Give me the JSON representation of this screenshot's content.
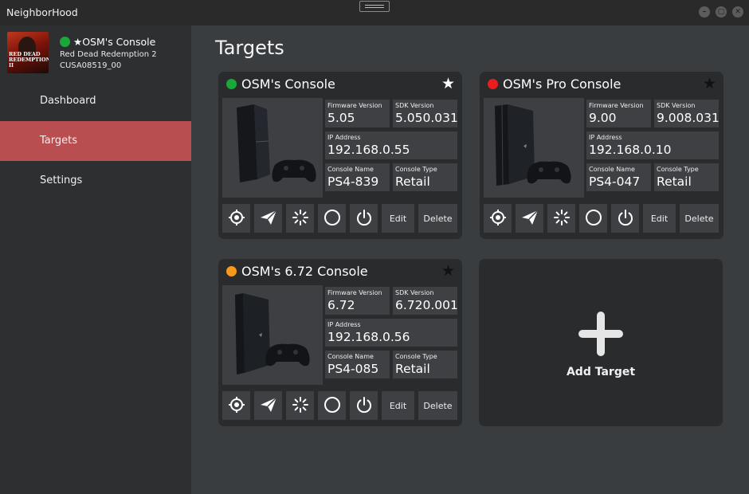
{
  "app": {
    "title": "NeighborHood"
  },
  "window": {
    "minimize_glyph": "–",
    "maximize_glyph": "▢",
    "close_glyph": "✕"
  },
  "sidebar": {
    "cover_text": "RED DEAD\nREDEMPTION II",
    "current_target": {
      "name": "★OSM's Console",
      "status_color": "#1aa83a"
    },
    "current_game": "Red Dead Redemption 2",
    "current_title_id": "CUSA08519_00",
    "nav": [
      {
        "label": "Dashboard",
        "active": false
      },
      {
        "label": "Targets",
        "active": true
      },
      {
        "label": "Settings",
        "active": false
      }
    ]
  },
  "page": {
    "title": "Targets"
  },
  "labels": {
    "firmware": "Firmware Version",
    "sdk": "SDK Version",
    "ip": "IP Address",
    "console_name": "Console Name",
    "console_type": "Console Type",
    "edit": "Edit",
    "delete": "Delete"
  },
  "targets": [
    {
      "name": "OSM's Console",
      "status_color": "#1aa83a",
      "default": true,
      "star_color": "#ffffff",
      "firmware": "5.05",
      "sdk": "5.050.031",
      "ip": "192.168.0.55",
      "console_name": "PS4-839",
      "console_type": "Retail",
      "model": "original"
    },
    {
      "name": "OSM's Pro Console",
      "status_color": "#e81d1d",
      "default": false,
      "star_color": "#111111",
      "firmware": "9.00",
      "sdk": "9.008.031",
      "ip": "192.168.0.10",
      "console_name": "PS4-047",
      "console_type": "Retail",
      "model": "pro"
    },
    {
      "name": "OSM's 6.72 Console",
      "status_color": "#f59a1a",
      "default": false,
      "star_color": "#111111",
      "firmware": "6.72",
      "sdk": "6.720.001",
      "ip": "192.168.0.56",
      "console_name": "PS4-085",
      "console_type": "Retail",
      "model": "slim"
    }
  ],
  "add_target": {
    "label": "Add Target"
  }
}
